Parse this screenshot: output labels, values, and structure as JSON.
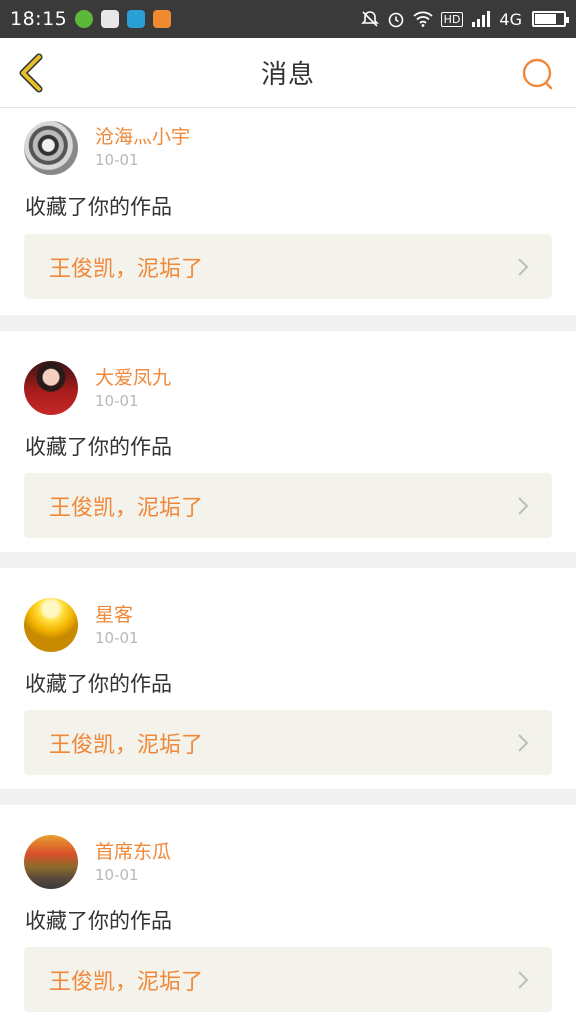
{
  "status_bar": {
    "time": "18:15",
    "network": "4G",
    "hd": "HD"
  },
  "header": {
    "title": "消息"
  },
  "messages": [
    {
      "username": "沧海灬小宇",
      "date": "10-01",
      "action": "收藏了你的作品",
      "work_title": "王俊凯，泥垢了"
    },
    {
      "username": "大爱凤九",
      "date": "10-01",
      "action": "收藏了你的作品",
      "work_title": "王俊凯，泥垢了"
    },
    {
      "username": "星客",
      "date": "10-01",
      "action": "收藏了你的作品",
      "work_title": "王俊凯，泥垢了"
    },
    {
      "username": "首席东瓜",
      "date": "10-01",
      "action": "收藏了你的作品",
      "work_title": "王俊凯，泥垢了"
    }
  ],
  "colors": {
    "accent": "#f0883a",
    "back_arrow": "#e6c02a",
    "card_box": "#f3f3ec"
  }
}
